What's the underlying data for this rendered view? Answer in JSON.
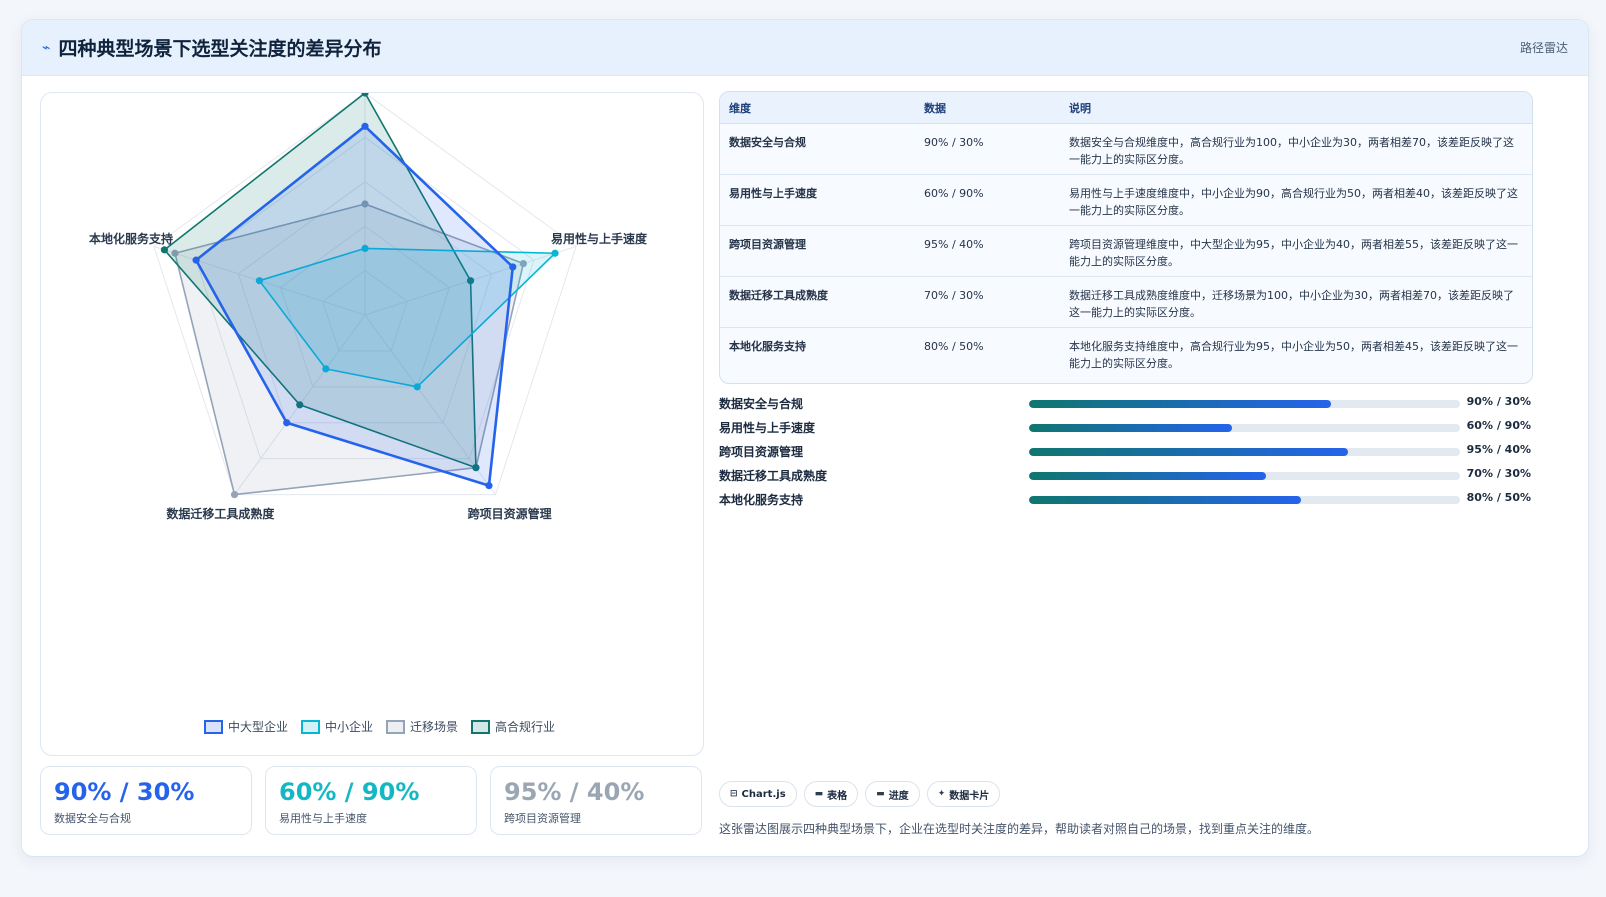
{
  "header": {
    "title": "四种典型场景下选型关注度的差异分布",
    "tag": "路径雷达",
    "icon": "line-icon"
  },
  "chart_data": {
    "type": "radar",
    "axes": [
      "数据安全与合规",
      "易用性与上手速度",
      "跨项目资源管理",
      "数据迁移工具成熟度",
      "本地化服务支持"
    ],
    "rmax": 100,
    "series": [
      {
        "name": "中大型企业",
        "color": "#2563eb",
        "values": [
          85,
          70,
          95,
          60,
          80
        ]
      },
      {
        "name": "中小企业",
        "color": "#06b6d4",
        "values": [
          30,
          90,
          40,
          30,
          50
        ]
      },
      {
        "name": "迁移场景",
        "color": "#94a3b8",
        "values": [
          50,
          75,
          85,
          100,
          90
        ]
      },
      {
        "name": "高合规行业",
        "color": "#0f766e",
        "values": [
          100,
          50,
          85,
          50,
          95
        ]
      }
    ]
  },
  "table": {
    "headers": [
      "维度",
      "数据",
      "说明"
    ],
    "rows": [
      {
        "dim": "数据安全与合规",
        "data": "90% / 30%",
        "desc": "数据安全与合规维度中，高合规行业为100，中小企业为30，两者相差70，该差距反映了这一能力上的实际区分度。"
      },
      {
        "dim": "易用性与上手速度",
        "data": "60% / 90%",
        "desc": "易用性与上手速度维度中，中小企业为90，高合规行业为50，两者相差40，该差距反映了这一能力上的实际区分度。"
      },
      {
        "dim": "跨项目资源管理",
        "data": "95% / 40%",
        "desc": "跨项目资源管理维度中，中大型企业为95，中小企业为40，两者相差55，该差距反映了这一能力上的实际区分度。"
      },
      {
        "dim": "数据迁移工具成熟度",
        "data": "70% / 30%",
        "desc": "数据迁移工具成熟度维度中，迁移场景为100，中小企业为30，两者相差70，该差距反映了这一能力上的实际区分度。"
      },
      {
        "dim": "本地化服务支持",
        "data": "80% / 50%",
        "desc": "本地化服务支持维度中，高合规行业为95，中小企业为50，两者相差45，该差距反映了这一能力上的实际区分度。"
      }
    ]
  },
  "progress": [
    {
      "label": "数据安全与合规",
      "value": "90% / 30%",
      "fill": 0.7
    },
    {
      "label": "易用性与上手速度",
      "value": "60% / 90%",
      "fill": 0.47
    },
    {
      "label": "跨项目资源管理",
      "value": "95% / 40%",
      "fill": 0.74
    },
    {
      "label": "数据迁移工具成熟度",
      "value": "70% / 30%",
      "fill": 0.55
    },
    {
      "label": "本地化服务支持",
      "value": "80% / 50%",
      "fill": 0.63
    }
  ],
  "stats": [
    {
      "value": "90% / 30%",
      "label": "数据安全与合规",
      "color": "#2563eb"
    },
    {
      "value": "60% / 90%",
      "label": "易用性与上手速度",
      "color": "#14b8c4"
    },
    {
      "value": "95% / 40%",
      "label": "跨项目资源管理",
      "color": "#9aa6b4"
    }
  ],
  "pills": [
    {
      "icon": "⊟",
      "label": "Chart.js"
    },
    {
      "icon": "▬",
      "label": "表格"
    },
    {
      "icon": "▬",
      "label": "进度"
    },
    {
      "icon": "✦",
      "label": "数据卡片"
    }
  ],
  "footnote": "这张雷达图展示四种典型场景下，企业在选型时关注度的差异，帮助读者对照自己的场景，找到重点关注的维度。"
}
